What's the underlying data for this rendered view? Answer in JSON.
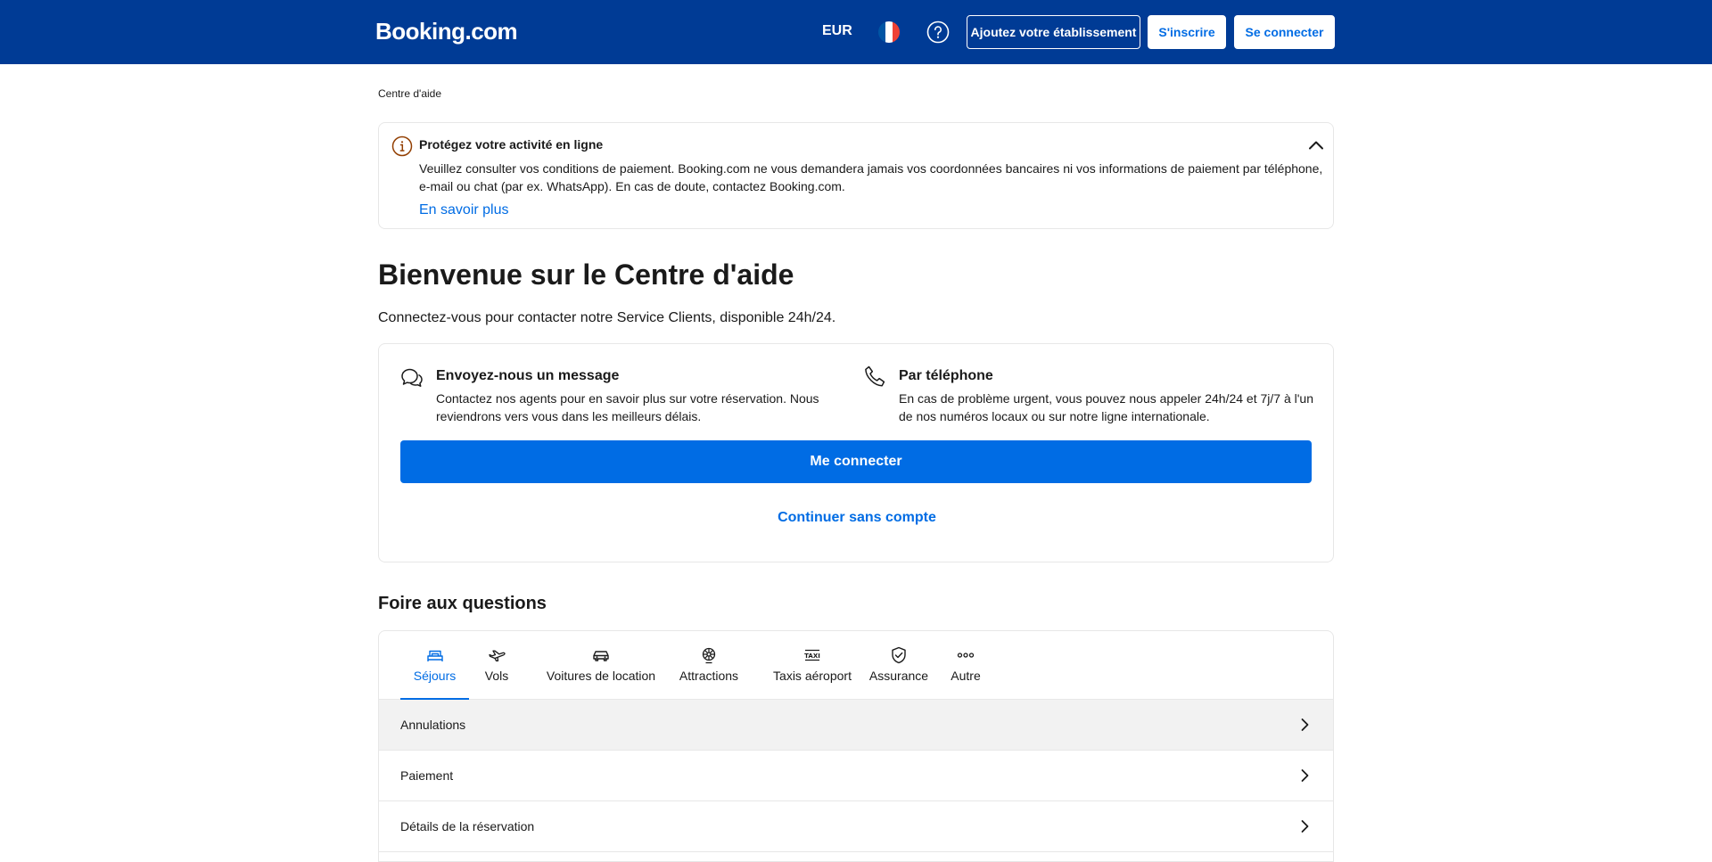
{
  "header": {
    "logo": "Booking.com",
    "currency": "EUR",
    "flag_icon": "france-flag-icon",
    "help_icon": "question-circle-icon",
    "add_property": "Ajoutez votre établissement",
    "register": "S'inscrire",
    "sign_in": "Se connecter",
    "colors": {
      "bar": "#003b95",
      "accent": "#006ce4"
    }
  },
  "breadcrumb": "Centre d'aide",
  "alert": {
    "icon": "info-circle-icon",
    "title": "Protégez votre activité en ligne",
    "body": "Veuillez consulter vos conditions de paiement. Booking.com ne vous demandera jamais vos coordonnées bancaires ni vos informations de paiement par téléphone, e-mail ou chat (par ex. WhatsApp). En cas de doute, contactez Booking.com.",
    "link": "En savoir plus",
    "collapse_icon": "chevron-up-icon"
  },
  "main": {
    "title": "Bienvenue sur le Centre d'aide",
    "subtitle": "Connectez-vous pour contacter notre Service Clients, disponible 24h/24."
  },
  "contact": {
    "message": {
      "icon": "chat-bubbles-icon",
      "title": "Envoyez-nous un message",
      "body": "Contactez nos agents pour en savoir plus sur votre réservation. Nous reviendrons vers vous dans les meilleurs délais."
    },
    "phone": {
      "icon": "phone-icon",
      "title": "Par téléphone",
      "body": "En cas de problème urgent, vous pouvez nous appeler 24h/24 et 7j/7 à l'un de nos numéros locaux ou sur notre ligne internationale."
    },
    "primary_button": "Me connecter",
    "secondary_link": "Continuer sans compte"
  },
  "faq": {
    "title": "Foire aux questions",
    "tabs": [
      {
        "label": "Séjours",
        "icon": "bed-icon",
        "active": true
      },
      {
        "label": "Vols",
        "icon": "plane-icon"
      },
      {
        "label": "Voitures de location",
        "icon": "car-icon"
      },
      {
        "label": "Attractions",
        "icon": "attractions-icon"
      },
      {
        "label": "Taxis aéroport",
        "icon": "taxi-icon"
      },
      {
        "label": "Assurance",
        "icon": "shield-check-icon"
      },
      {
        "label": "Autre",
        "icon": "more-dots-icon"
      }
    ],
    "rows": [
      {
        "label": "Annulations"
      },
      {
        "label": "Paiement"
      },
      {
        "label": "Détails de la réservation"
      }
    ],
    "row_icon": "chevron-right-icon"
  }
}
